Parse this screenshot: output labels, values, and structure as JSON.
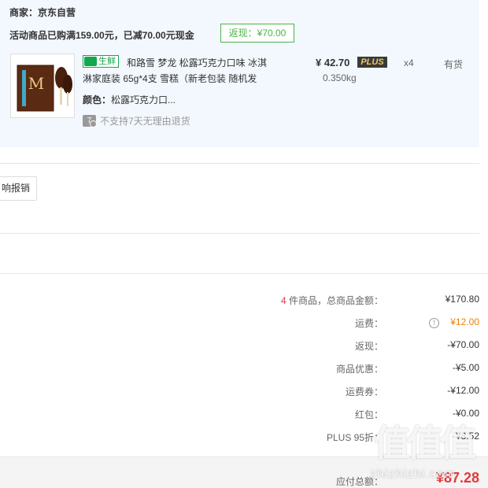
{
  "order": {
    "seller": "商家：京东自营",
    "promo": "活动商品已购满159.00元，已减70.00元现金",
    "rebate_badge": "返现：¥70.00"
  },
  "item": {
    "fresh_tag": "生鲜",
    "title_line1": "和路雪 梦龙 松露巧克力口味 冰淇",
    "title_line2": "淋家庭装 65g*4支 雪糕（新老包装 随机发",
    "color_label": "颜色：",
    "color_value": "松露巧克力口...",
    "return_icon_text": "7",
    "return_note": "不支持7天无理由退货",
    "price": "¥ 42.70",
    "plus_badge": "PLUS",
    "weight": "0.350kg",
    "quantity": "x4",
    "stock": "有货",
    "image_label": "M"
  },
  "invoice": {
    "button_label": "响报销"
  },
  "summary": {
    "goods_count": "4",
    "goods_label": " 件商品，总商品金额：",
    "goods_amount": "¥170.80",
    "shipping_label": "运费：",
    "shipping_value": "¥12.00",
    "rebate_label": "返现：",
    "rebate_value": "-¥70.00",
    "discount_label": "商品优惠：",
    "discount_value": "-¥5.00",
    "shipping_coupon_label": "运费券：",
    "shipping_coupon_value": "-¥12.00",
    "red_packet_label": "红包：",
    "red_packet_value": "-¥0.00",
    "plus_label": "PLUS 95折：",
    "plus_value": "-¥8.52",
    "payable_label": "应付总额：",
    "payable_value": "¥87.28"
  },
  "watermark": {
    "text": "值值值",
    "url": "zhizhizhi.com"
  },
  "colors": {
    "panel_bg": "#f3f8fe",
    "accent_green": "#4ab449",
    "accent_red": "#e4393c",
    "accent_orange": "#f07f00"
  }
}
